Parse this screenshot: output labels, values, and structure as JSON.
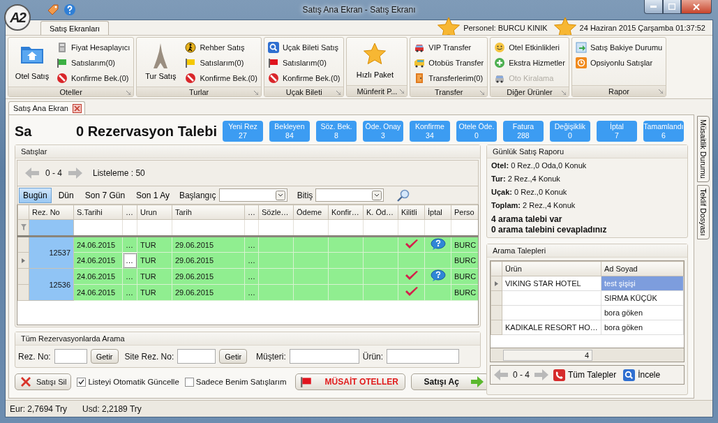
{
  "window": {
    "title": "Satış Ana Ekran - Satış Ekranı",
    "logo": "A2"
  },
  "ribbon_tab": {
    "label": "Satış Ekranları",
    "selected": true
  },
  "personnel": "Personel: BURCU KINIK",
  "datetime": "24 Haziran 2015 Çarşamba 01:37:52",
  "ribbon_groups": [
    {
      "label": "Oteller",
      "large": {
        "label": "Otel Satış",
        "kind": "folder"
      },
      "items": [
        {
          "label": "Fiyat Hesaplayıcı",
          "kind": "calculator",
          "disabled": false
        },
        {
          "label": "Satıslarım(0)",
          "kind": "flag",
          "color": "#3cb043",
          "disabled": false
        },
        {
          "label": "Konfirme Bek.(0)",
          "kind": "stop",
          "disabled": false
        }
      ]
    },
    {
      "label": "Turlar",
      "large": {
        "label": "Tur Satış",
        "kind": "tower"
      },
      "items": [
        {
          "label": "Rehber Satış",
          "kind": "walker",
          "disabled": false
        },
        {
          "label": "Satıslarım(0)",
          "kind": "flag",
          "color": "#f5c800",
          "disabled": false
        },
        {
          "label": "Konfirme Bek.(0)",
          "kind": "stop",
          "disabled": false
        }
      ]
    },
    {
      "label": "Uçak Bileti",
      "items": [
        {
          "label": "Uçak Bileti Satış",
          "kind": "search",
          "disabled": false
        },
        {
          "label": "Satıslarım(0)",
          "kind": "flag",
          "color": "#e0141e",
          "disabled": false
        },
        {
          "label": "Konfirme Bek.(0)",
          "kind": "stop",
          "disabled": false
        }
      ]
    },
    {
      "label": "Münferit P...",
      "large": {
        "label": "Hızlı Paket",
        "kind": "star"
      }
    },
    {
      "label": "Transfer",
      "items": [
        {
          "label": "VIP Transfer",
          "kind": "car",
          "disabled": false
        },
        {
          "label": "Otobüs Transfer",
          "kind": "bus",
          "disabled": false
        },
        {
          "label": "Transferlerim(0)",
          "kind": "door",
          "disabled": false
        }
      ]
    },
    {
      "label": "Diğer Ürünler",
      "items": [
        {
          "label": "Otel Etkinlikleri",
          "kind": "smiley",
          "disabled": false
        },
        {
          "label": "Ekstra Hizmetler",
          "kind": "plus",
          "disabled": false
        },
        {
          "label": "Oto Kiralama",
          "kind": "car",
          "disabled": true
        }
      ]
    },
    {
      "label": "Rapor",
      "items": [
        {
          "label": "Satış Bakiye Durumu",
          "kind": "report",
          "disabled": false
        },
        {
          "label": "Opsiyonlu Satışlar",
          "kind": "clock",
          "disabled": false
        }
      ]
    }
  ],
  "doc_tab": {
    "label": "Satış Ana Ekran",
    "selected": true
  },
  "heading": {
    "cut_title": "Sa",
    "title": "0 Rezervasyon Talebi"
  },
  "counters": [
    {
      "label": "Yeni Rez",
      "value": "27"
    },
    {
      "label": "Bekleyen",
      "value": "84"
    },
    {
      "label": "Söz. Bek.",
      "value": "8"
    },
    {
      "label": "Öde. Onay",
      "value": "3"
    },
    {
      "label": "Konfirme",
      "value": "34"
    },
    {
      "label": "Otele Öde.",
      "value": "0"
    },
    {
      "label": "Fatura",
      "value": "288"
    },
    {
      "label": "Değişiklik",
      "value": "0"
    },
    {
      "label": "İptal",
      "value": "7"
    },
    {
      "label": "Tamamlandı",
      "value": "6"
    }
  ],
  "sales": {
    "title": "Satışlar",
    "range": "0 - 4",
    "listing": "Listeleme : 50",
    "date_filters": [
      {
        "label": "Bugün",
        "selected": true
      },
      {
        "label": "Dün",
        "selected": false
      },
      {
        "label": "Son 7 Gün",
        "selected": false
      },
      {
        "label": "Son 1 Ay",
        "selected": false
      }
    ],
    "start_label": "Başlangıç",
    "end_label": "Bitiş",
    "columns": [
      "Rez. No",
      "S.Tarihi",
      "…",
      "Urun",
      "Tarih",
      "…",
      "Sözle…",
      "Ödeme",
      "Konfir…",
      "K. Öd…",
      "Kilitli",
      "İptal",
      "Perso"
    ],
    "rows": [
      {
        "rez_no": "12537",
        "lines": [
          {
            "cells": [
              "24.06.2015",
              "…",
              "TUR",
              "29.06.2015",
              "…"
            ],
            "locked": true,
            "note": true,
            "person": "BURC",
            "selected": false
          },
          {
            "cells": [
              "24.06.2015",
              "…",
              "TUR",
              "29.06.2015",
              "…"
            ],
            "locked": false,
            "note": false,
            "person": "BURC",
            "selected": true
          }
        ]
      },
      {
        "rez_no": "12536",
        "lines": [
          {
            "cells": [
              "24.06.2015",
              "…",
              "TUR",
              "29.06.2015",
              "…"
            ],
            "locked": true,
            "note": true,
            "person": "BURC",
            "selected": false
          },
          {
            "cells": [
              "24.06.2015",
              "…",
              "TUR",
              "29.06.2015",
              "…"
            ],
            "locked": true,
            "note": false,
            "person": "BURC",
            "selected": false
          }
        ]
      }
    ]
  },
  "search": {
    "title": "Tüm Rezervasyonlarda Arama",
    "rez_label": "Rez. No:",
    "site_label": "Site Rez. No:",
    "fetch_buttons": [
      "Getir",
      "Getir"
    ],
    "customer_label": "Müşteri:",
    "product_label": "Ürün:"
  },
  "actions": {
    "delete": "Satışı Sil",
    "auto_update": {
      "label": "Listeyi Otomatik Güncelle",
      "checked": true
    },
    "only_mine": {
      "label": "Sadece Benim Satışlarım",
      "checked": false
    },
    "available": "MÜSAİT OTELLER",
    "open": "Satışı Aç"
  },
  "report": {
    "title": "Günlük Satış Raporu",
    "lines": [
      {
        "label": "Otel:",
        "value": "0 Rez.,0 Oda,0 Konuk"
      },
      {
        "label": "Tur:",
        "value": "2 Rez.,4 Konuk"
      },
      {
        "label": "Uçak:",
        "value": "0 Rez.,0 Konuk"
      },
      {
        "label": "Toplam:",
        "value": "2 Rez.,4 Konuk"
      }
    ],
    "summary": [
      "4 arama talebi var",
      "0 arama talebini cevapladınız"
    ]
  },
  "calls": {
    "title": "Arama Talepleri",
    "columns": [
      "Ürün",
      "Ad Soyad"
    ],
    "rows": [
      {
        "product": "VIKING STAR HOTEL",
        "name": "test şişişi",
        "selected": true
      },
      {
        "name": "SIRMA KÜÇÜK",
        "selected": false
      },
      {
        "name": "bora göken",
        "selected": false
      },
      {
        "product": "KADIKALE RESORT HO…",
        "name": "bora göken",
        "selected": false
      }
    ],
    "count": "4",
    "range": "0 - 4",
    "all_button": "Tüm Talepler",
    "inspect_button": "İncele"
  },
  "side_tabs": [
    "Müsaitlik Durumu",
    "Teklif Dosyası"
  ],
  "status_bar": [
    "Eur: 2,7694 Try",
    "Usd: 2,2189 Try"
  ]
}
